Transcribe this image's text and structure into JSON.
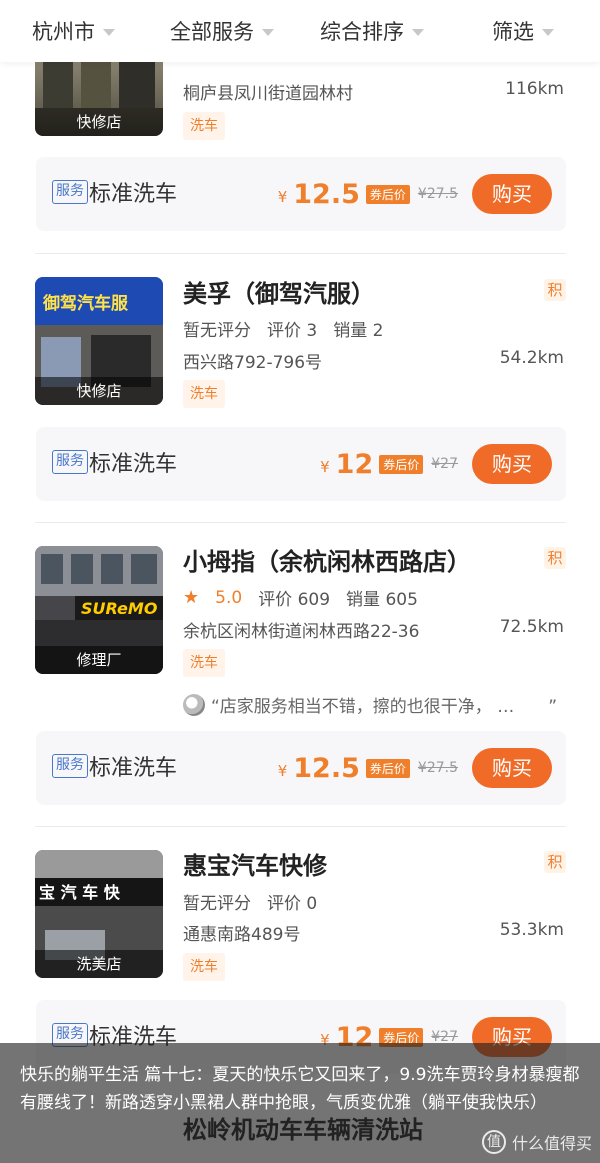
{
  "filters": [
    "杭州市",
    "全部服务",
    "综合排序",
    "筛选"
  ],
  "stores": [
    {
      "name": "",
      "thumb_label": "快修店",
      "rating_text": "",
      "address": "桐庐县凤川街道园林村",
      "distance": "116km",
      "tag": "洗车",
      "deal": {
        "badge": "服务",
        "name": "标准洗车",
        "yen": "¥",
        "price": "12.5",
        "coupon": "券后价",
        "orig": "¥27.5",
        "buy": "购买"
      }
    },
    {
      "name": "美孚（御驾汽服）",
      "ji": "积",
      "thumb_label": "快修店",
      "rating_text": "暂无评分",
      "reviews": "评价 3",
      "sales": "销量 2",
      "address": "西兴路792-796号",
      "distance": "54.2km",
      "tag": "洗车",
      "deal": {
        "badge": "服务",
        "name": "标准洗车",
        "yen": "¥",
        "price": "12",
        "coupon": "券后价",
        "orig": "¥27",
        "buy": "购买"
      }
    },
    {
      "name": "小拇指（余杭闲林西路店）",
      "ji": "积",
      "thumb_label": "修理厂",
      "score": "5.0",
      "reviews": "评价 609",
      "sales": "销量 605",
      "address": "余杭区闲林街道闲林西路22-36",
      "distance": "72.5km",
      "tag": "洗车",
      "review": "“店家服务相当不错，擦的也很干净， …　　”",
      "deal": {
        "badge": "服务",
        "name": "标准洗车",
        "yen": "¥",
        "price": "12.5",
        "coupon": "券后价",
        "orig": "¥27.5",
        "buy": "购买"
      }
    },
    {
      "name": "惠宝汽车快修",
      "ji": "积",
      "thumb_label": "洗美店",
      "rating_text": "暂无评分",
      "reviews": "评价 0",
      "address": "通惠南路489号",
      "distance": "53.3km",
      "tag": "洗车",
      "deal": {
        "badge": "服务",
        "name": "标准洗车",
        "yen": "¥",
        "price": "12",
        "coupon": "券后价",
        "orig": "¥27",
        "buy": "购买"
      }
    }
  ],
  "overlay": {
    "caption": "快乐的躺平生活 篇十七：夏天的快乐它又回来了，9.9洗车贾玲身材暴瘦都有腰线了！新路透穿小黑裙人群中抢眼，气质变优雅（躺平使我快乐）",
    "next_store": "松岭机动车车辆清洗站",
    "watermark": "什么值得买",
    "watermark_icon": "值"
  }
}
